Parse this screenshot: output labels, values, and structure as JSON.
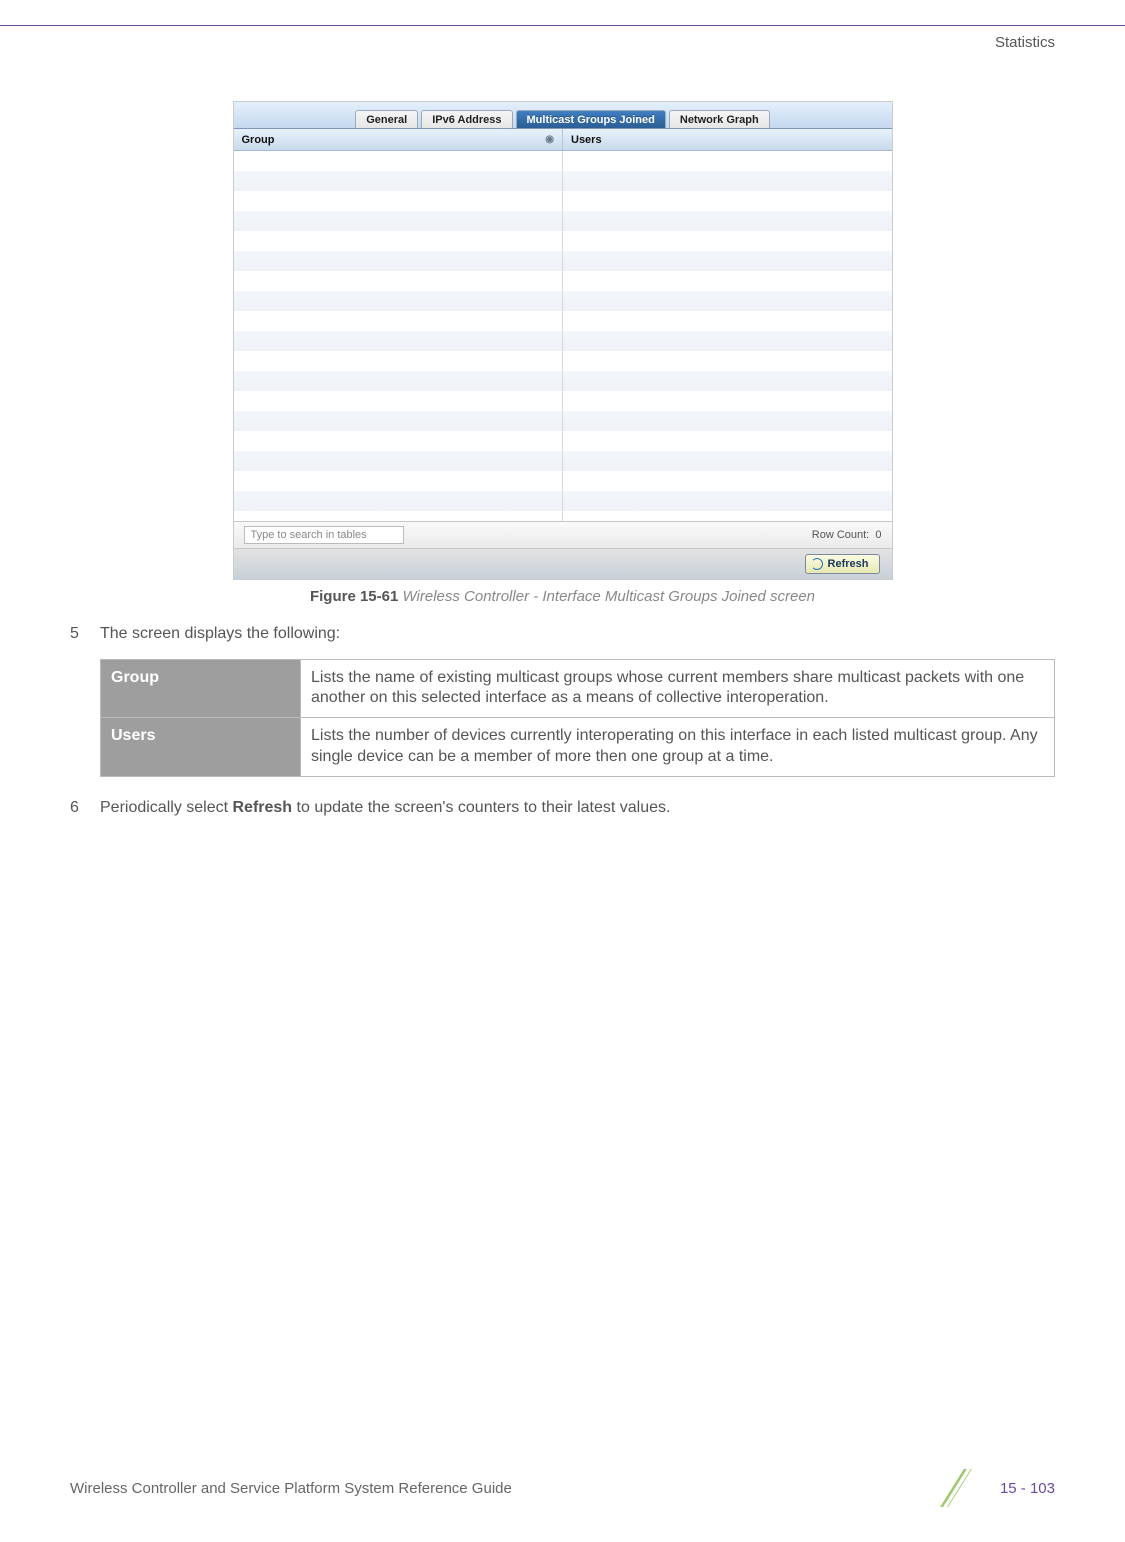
{
  "header": {
    "section": "Statistics"
  },
  "screenshot": {
    "tabs": {
      "general": "General",
      "ipv6": "IPv6 Address",
      "multicast": "Multicast Groups Joined",
      "network": "Network Graph"
    },
    "columns": {
      "group": "Group",
      "users": "Users"
    },
    "search": {
      "placeholder": "Type to search in tables"
    },
    "rowcount_label": "Row Count:",
    "rowcount_value": "0",
    "refresh": "Refresh"
  },
  "figure": {
    "label": "Figure 15-61",
    "desc": "Wireless Controller - Interface Multicast Groups Joined screen"
  },
  "step5": {
    "num": "5",
    "text": "The screen displays the following:"
  },
  "table": {
    "r1label": "Group",
    "r1text": "Lists the name of existing multicast groups whose current members share multicast packets with one another on this selected interface as a means of collective interoperation.",
    "r2label": "Users",
    "r2text": "Lists the number of devices currently interoperating on this interface in each listed multicast group. Any single device can be a member of more then one group at a time."
  },
  "step6": {
    "num": "6",
    "pre": "Periodically select ",
    "bold": "Refresh",
    "post": " to update the screen's counters to their latest values."
  },
  "footer": {
    "left": "Wireless Controller and Service Platform System Reference Guide",
    "page": "15 - 103"
  }
}
